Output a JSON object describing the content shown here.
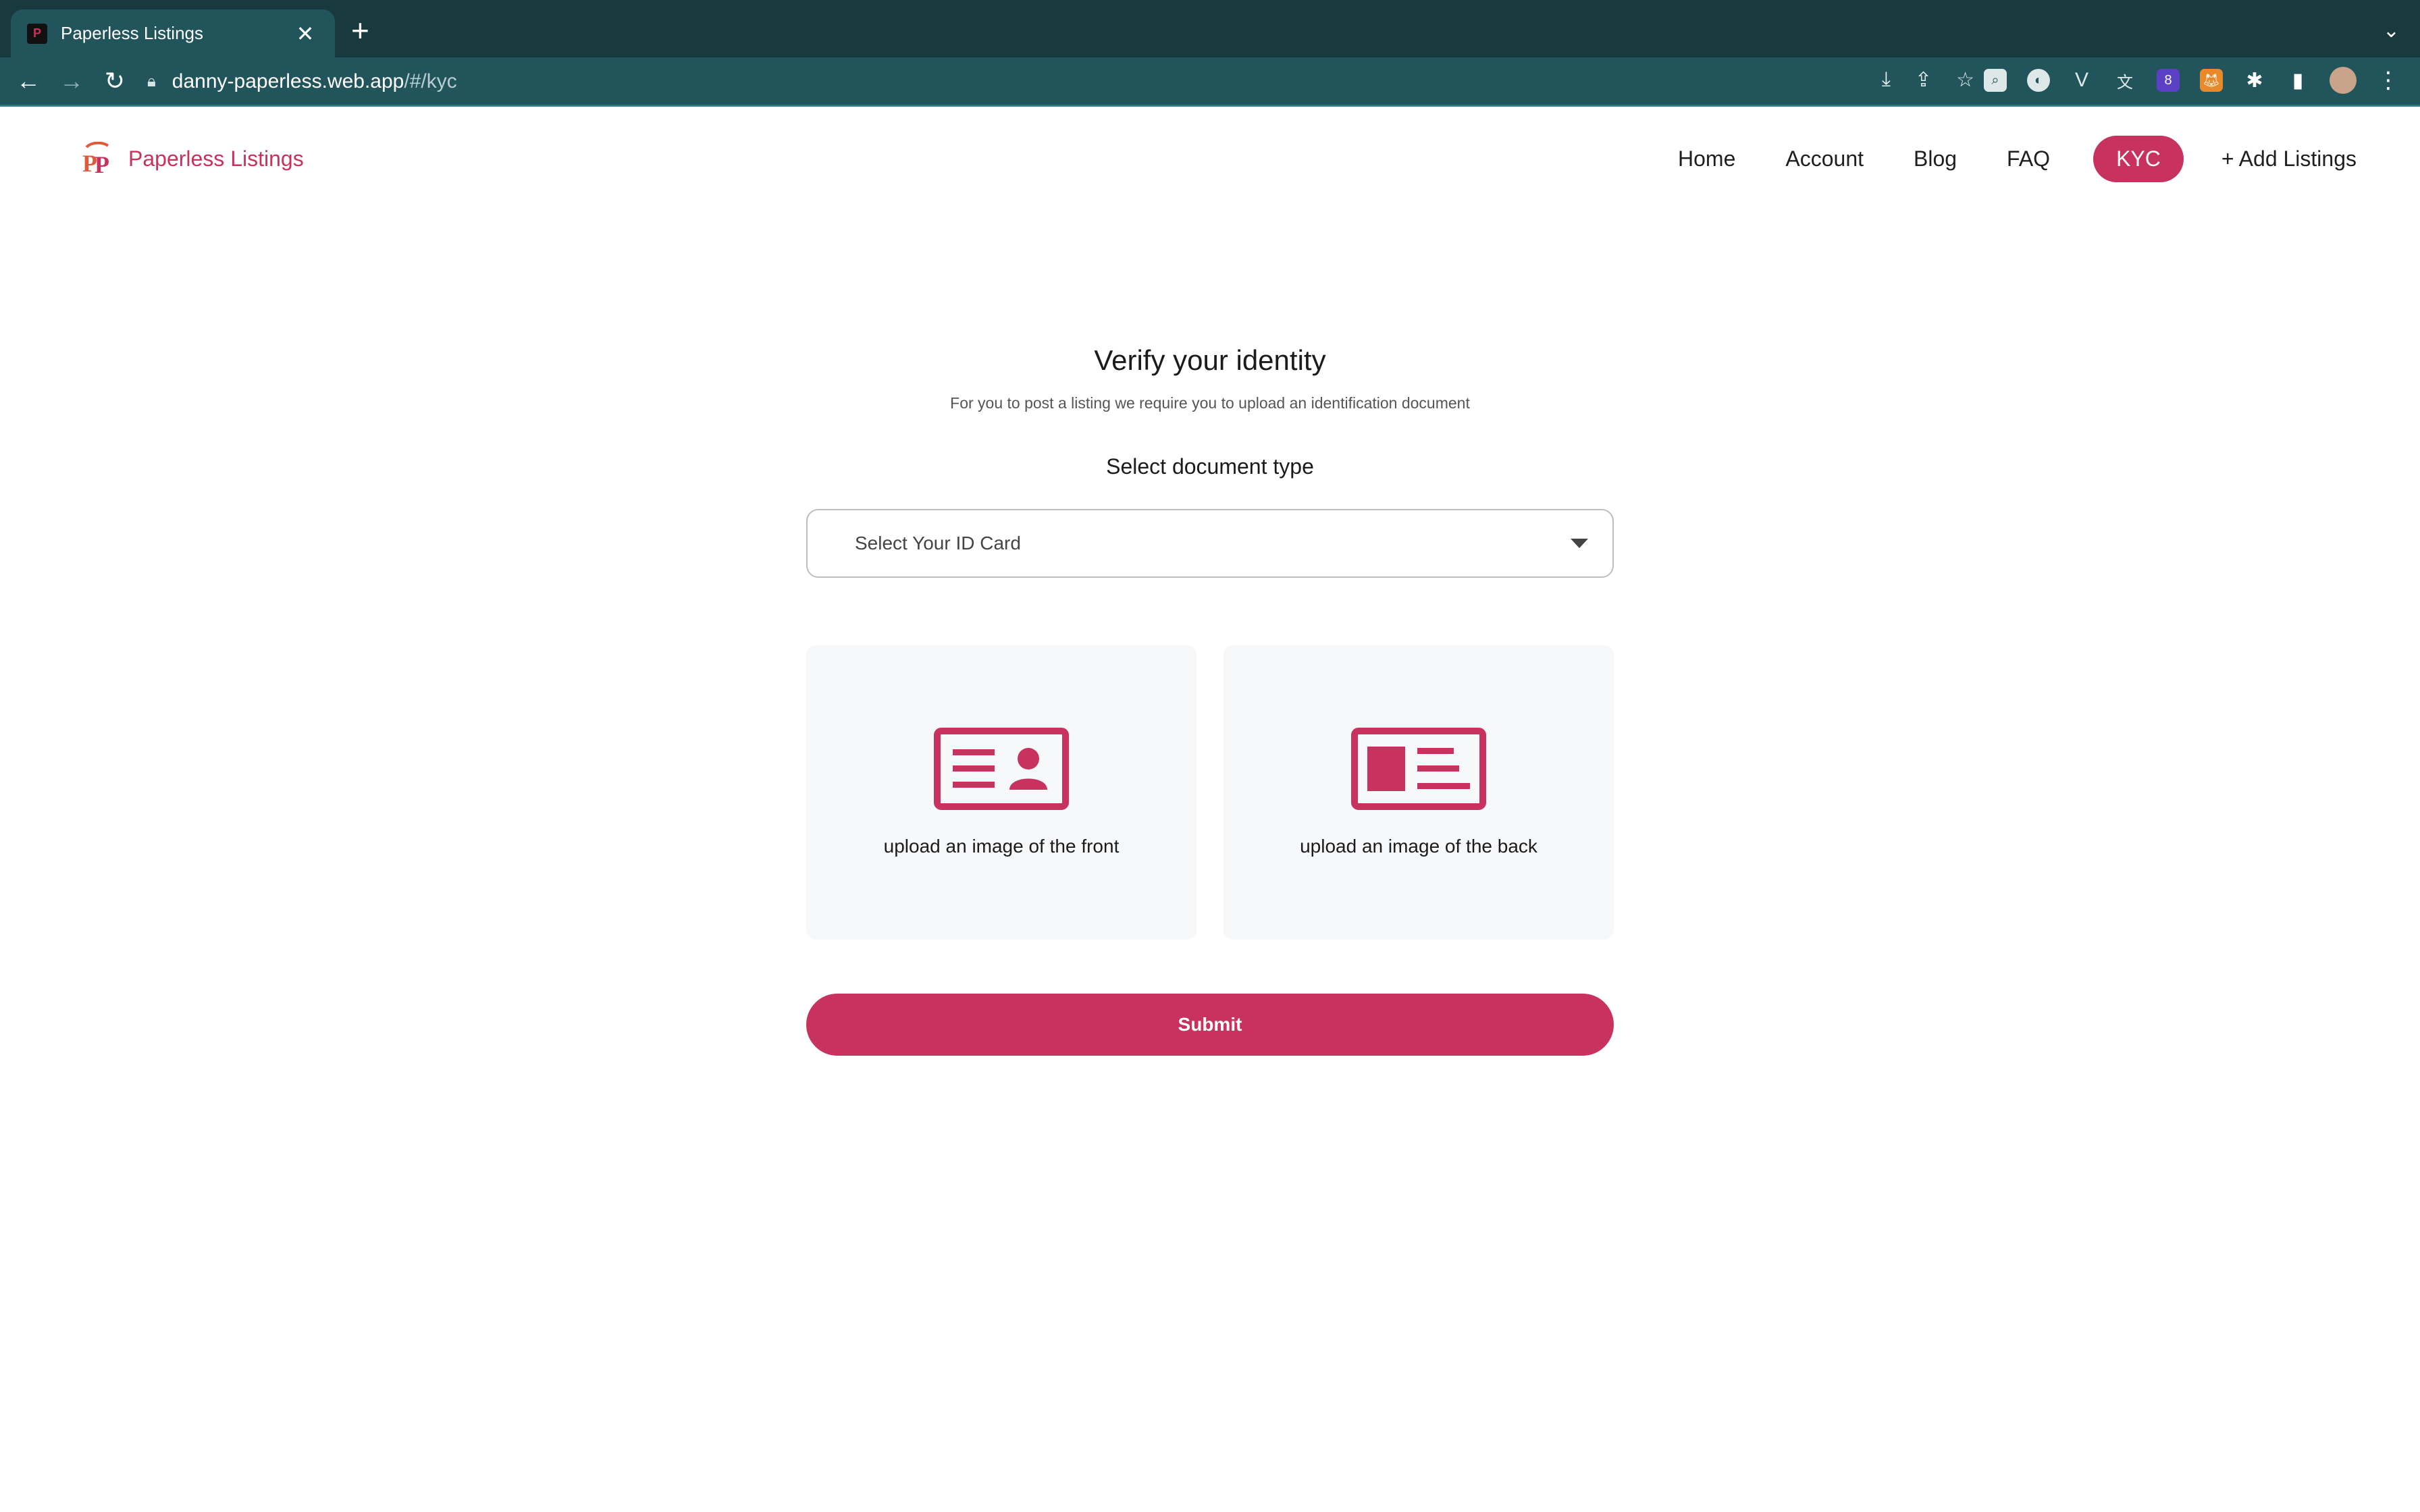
{
  "browser": {
    "tab_title": "Paperless Listings",
    "url_host": "danny-paperless.web.app",
    "url_path": "/#/kyc",
    "ext_badge": "8"
  },
  "site": {
    "brand": "Paperless Listings",
    "logo_letters": "PP",
    "nav": [
      {
        "label": "Home"
      },
      {
        "label": "Account"
      },
      {
        "label": "Blog"
      },
      {
        "label": "FAQ"
      },
      {
        "label": "KYC"
      },
      {
        "label": "+ Add Listings"
      }
    ],
    "active_nav": "KYC"
  },
  "kyc": {
    "title": "Verify your identity",
    "subtitle": "For you to post a listing we require you to upload an identification document",
    "doc_label": "Select document type",
    "select_placeholder": "Select Your ID Card",
    "upload_front": "upload an image of the front",
    "upload_back": "upload an image of the back",
    "submit": "Submit"
  },
  "colors": {
    "accent": "#c8325e",
    "chrome_dark": "#183a3f",
    "chrome": "#21545b",
    "card_bg": "#f7f8fa"
  }
}
